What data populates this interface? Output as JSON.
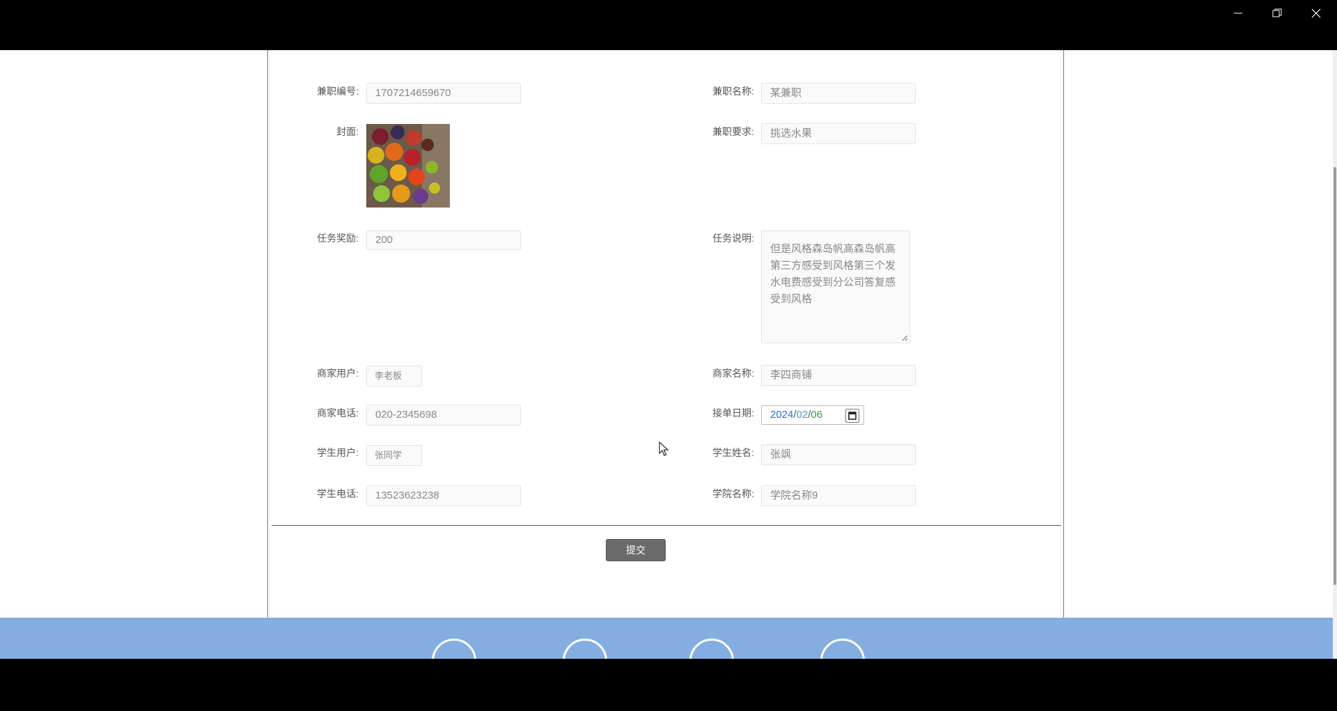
{
  "window": {
    "minimize_icon": "minimize-icon",
    "restore_icon": "restore-icon",
    "close_icon": "close-icon"
  },
  "form": {
    "job_id": {
      "label": "兼职编号:",
      "value": "1707214659670"
    },
    "job_name": {
      "label": "兼职名称:",
      "value": "某兼职"
    },
    "cover": {
      "label": "封面:",
      "image": "fruit-cover-image"
    },
    "job_requirement": {
      "label": "兼职要求:",
      "value": "挑选水果"
    },
    "reward": {
      "label": "任务奖励:",
      "value": "200"
    },
    "description": {
      "label": "任务说明:",
      "value": "但是风格森岛帆高森岛帆高第三方感受到风格第三个发水电费感受到分公司答复感受到风格"
    },
    "merchant_user": {
      "label": "商家用户:",
      "value": "李老板"
    },
    "merchant_name": {
      "label": "商家名称:",
      "value": "李四商铺"
    },
    "merchant_phone": {
      "label": "商家电话:",
      "value": "020-2345698"
    },
    "accept_date": {
      "label": "接单日期:",
      "year": "2024",
      "month": "02",
      "day": "06",
      "sep": "/"
    },
    "student_user": {
      "label": "学生用户:",
      "value": "张同学"
    },
    "student_name": {
      "label": "学生姓名:",
      "value": "张飒"
    },
    "student_phone": {
      "label": "学生电话:",
      "value": "13523623238"
    },
    "college_name": {
      "label": "学院名称:",
      "value": "学院名称9"
    },
    "submit_label": "提交"
  },
  "colors": {
    "footer_band": "#84aee1",
    "submit_button": "#6b6b6b"
  }
}
